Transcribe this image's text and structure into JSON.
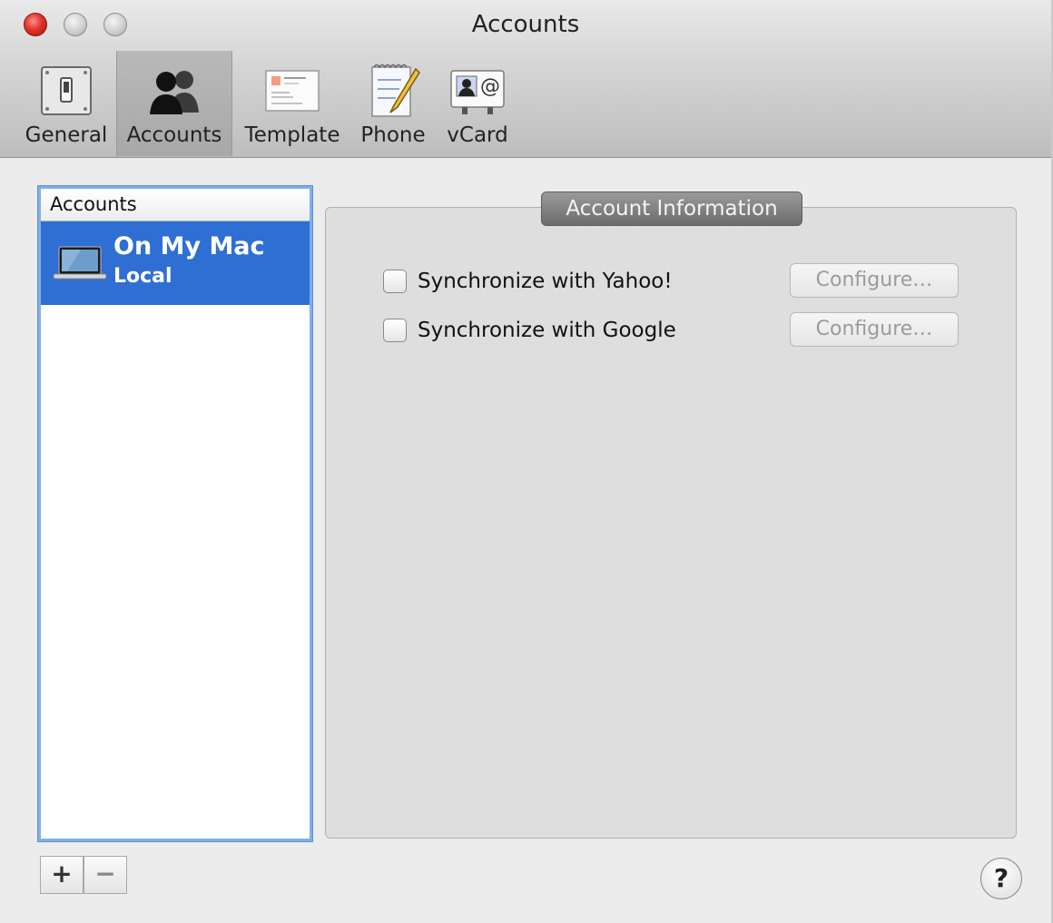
{
  "window": {
    "title": "Accounts"
  },
  "toolbar": {
    "items": [
      {
        "label": "General",
        "icon": "switch-icon",
        "selected": false
      },
      {
        "label": "Accounts",
        "icon": "people-icon",
        "selected": true
      },
      {
        "label": "Template",
        "icon": "template-card-icon",
        "selected": false
      },
      {
        "label": "Phone",
        "icon": "notepad-pencil-icon",
        "selected": false
      },
      {
        "label": "vCard",
        "icon": "vcard-icon",
        "selected": false
      }
    ]
  },
  "accounts_list": {
    "header": "Accounts",
    "items": [
      {
        "name": "On My Mac",
        "subtitle": "Local",
        "icon": "laptop-icon",
        "selected": true
      }
    ],
    "add_label": "+",
    "remove_label": "−"
  },
  "account_info": {
    "title": "Account Information",
    "options": [
      {
        "label": "Synchronize with Yahoo!",
        "checked": false,
        "button": "Configure…"
      },
      {
        "label": "Synchronize with Google",
        "checked": false,
        "button": "Configure…"
      }
    ]
  },
  "help": {
    "label": "?"
  },
  "colors": {
    "selection": "#2f6fd3",
    "focus_ring": "#7fb0e6"
  }
}
